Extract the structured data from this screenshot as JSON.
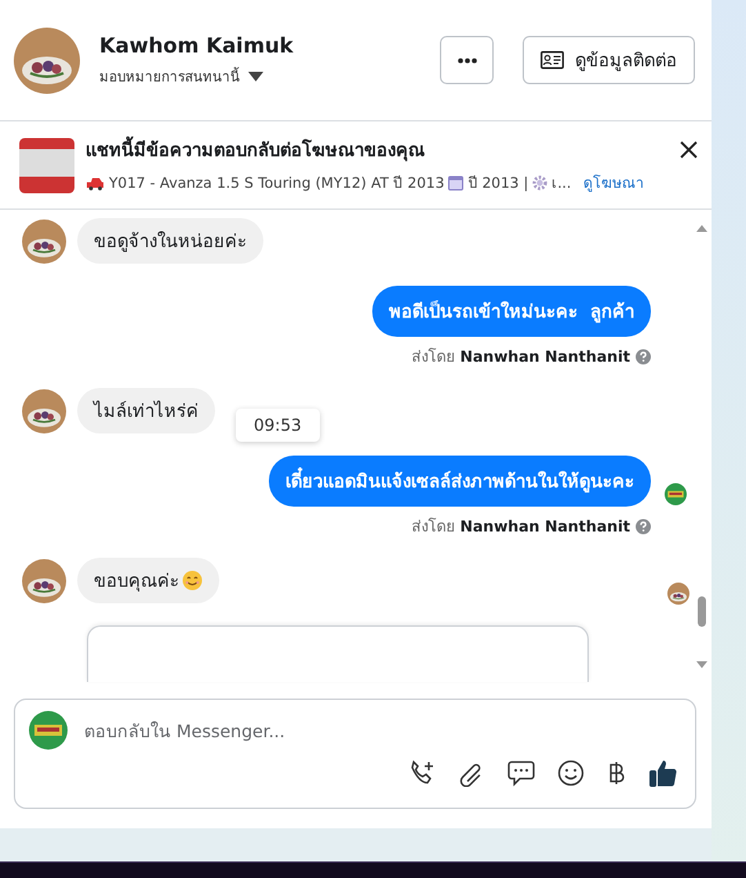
{
  "header": {
    "name": "Kawhom Kaimuk",
    "assign_label": "มอบหมายการสนทนานี้",
    "contact_button": "ดูข้อมูลติดต่อ"
  },
  "ad_banner": {
    "title": "แชทนี้มีข้อความตอบกลับต่อโฆษณาของคุณ",
    "details": [
      "Y017 - Avanza 1.5 S Touring (MY12) AT ปี 2013",
      "ปี 2013 |",
      "เ..."
    ],
    "link": "ดูโฆษณา"
  },
  "messages": [
    {
      "kind": "incoming",
      "text": "ขอดูจ้างในหน่อยค่ะ",
      "emoji": false,
      "read_receipt": false
    },
    {
      "kind": "outgoing",
      "text": "พอดีเป็นรถเข้าใหม่นะคะ  ลูกค้า",
      "sender_prefix": "ส่งโดย",
      "sender": "Nanwhan Nanthanit",
      "read_receipt": false
    },
    {
      "kind": "incoming",
      "text": "ไมล์เท่าไหร่ค่",
      "tooltip": "09:53",
      "emoji": false,
      "read_receipt": false
    },
    {
      "kind": "outgoing",
      "text": "เดี๋ยวแอดมินแจ้งเซลล์ส่งภาพด้านในให้ดูนะคะ",
      "sender_prefix": "ส่งโดย",
      "sender": "Nanwhan Nanthanit",
      "read_receipt": true
    },
    {
      "kind": "incoming",
      "text": "ขอบคุณค่ะ",
      "emoji": true,
      "read_receipt": true
    },
    {
      "kind": "card"
    }
  ],
  "composer": {
    "placeholder": "ตอบกลับใน Messenger..."
  }
}
